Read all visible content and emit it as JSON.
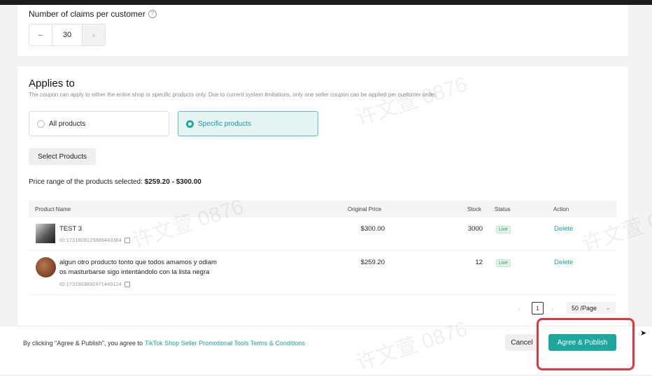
{
  "claims": {
    "label": "Number of claims per customer",
    "help_icon": "?",
    "minus": "−",
    "value": "30",
    "plus": "+"
  },
  "applies": {
    "title": "Applies to",
    "description": "The coupon can apply to either the entire shop or specific products only. Due to current system limitations, only one seller coupon can be applied per customer order.",
    "options": [
      {
        "label": "All products",
        "selected": false
      },
      {
        "label": "Specific products",
        "selected": true
      }
    ],
    "select_button": "Select Products",
    "price_range_label": "Price range of the products selected: ",
    "price_range_value": "$259.20 - $300.00"
  },
  "table": {
    "headers": [
      "Product Name",
      "Original Price",
      "Stock",
      "Status",
      "Action"
    ],
    "rows": [
      {
        "name": "TEST 3",
        "id": "ID:1731809125889443364",
        "price": "$300.00",
        "stock": "3000",
        "status": "Live",
        "action": "Delete"
      },
      {
        "name_line1": "algun otro producto tonto que todos amamos y odiam",
        "name_line2": "os masturbarse sigo intentándolo con la lista negra",
        "id": "ID:1731903892471449124",
        "price": "$259.20",
        "stock": "12",
        "status": "Live",
        "action": "Delete"
      }
    ]
  },
  "pagination": {
    "prev": "‹",
    "page": "1",
    "next": "›",
    "page_size": "50 /Page",
    "chevron": "⌄"
  },
  "footer": {
    "terms_prefix": "By clicking \"Agree & Publish\", you agree to",
    "terms_link": "TikTok Shop Seller Promotional Tools Terms & Conditions",
    "cancel": "Cancel",
    "publish": "Agree & Publish"
  },
  "watermark": "许文萱 0876",
  "colors": {
    "accent": "#1ea79e",
    "highlight": "#e0373f",
    "live_text": "#1a9a60"
  }
}
